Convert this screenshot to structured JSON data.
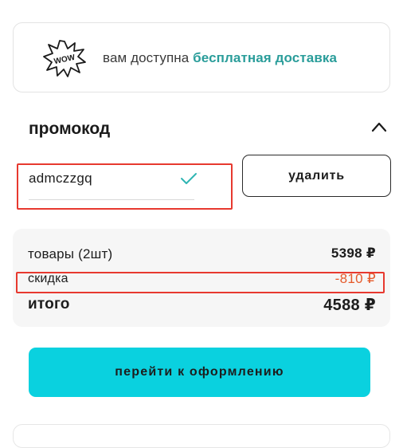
{
  "banner": {
    "icon": "wow-icon",
    "badge_text": "WOW",
    "text": "вам доступна",
    "accent_text": "бесплатная доставка",
    "accent_color": "#2a9d9a"
  },
  "promo": {
    "title": "промокод",
    "collapse_icon": "chevron-up-icon",
    "code_value": "admczzgq",
    "status_icon": "check-icon",
    "remove_label": "удалить"
  },
  "summary": {
    "goods_label": "товары (2шт)",
    "goods_value": "5398 ₽",
    "discount_label": "скидка",
    "discount_value": "-810 ₽",
    "discount_color": "#e55a2b",
    "total_label": "итого",
    "total_value": "4588 ₽"
  },
  "checkout": {
    "label": "перейти к оформлению",
    "color": "#0ad1df"
  },
  "annotations": {
    "highlight_color": "#e7392f"
  }
}
